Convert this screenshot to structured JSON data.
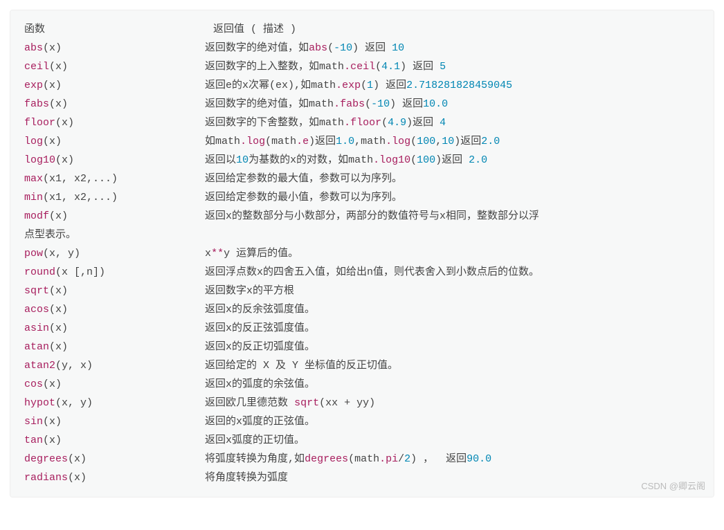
{
  "watermark": "CSDN @卿云阁",
  "lines": [
    {
      "segs": [
        {
          "t": "函数                           返回值 ( 描述 )",
          "c": "p"
        }
      ]
    },
    {
      "segs": [
        {
          "t": "abs",
          "c": "fn"
        },
        {
          "t": "(x)                       返回数字的绝对值，如",
          "c": "p"
        },
        {
          "t": "abs",
          "c": "fn"
        },
        {
          "t": "(",
          "c": "p"
        },
        {
          "t": "-10",
          "c": "num"
        },
        {
          "t": ") 返回 ",
          "c": "p"
        },
        {
          "t": "10",
          "c": "num"
        }
      ]
    },
    {
      "segs": [
        {
          "t": "ceil",
          "c": "fn"
        },
        {
          "t": "(x)                      返回数字的上入整数，如math",
          "c": "p"
        },
        {
          "t": ".ceil",
          "c": "fn"
        },
        {
          "t": "(",
          "c": "p"
        },
        {
          "t": "4.1",
          "c": "num"
        },
        {
          "t": ") 返回 ",
          "c": "p"
        },
        {
          "t": "5",
          "c": "num"
        }
      ]
    },
    {
      "segs": [
        {
          "t": "exp",
          "c": "fn"
        },
        {
          "t": "(x)                       返回e的x次幂(ex),如math",
          "c": "p"
        },
        {
          "t": ".exp",
          "c": "fn"
        },
        {
          "t": "(",
          "c": "p"
        },
        {
          "t": "1",
          "c": "num"
        },
        {
          "t": ") 返回",
          "c": "p"
        },
        {
          "t": "2.718281828459045",
          "c": "num"
        }
      ]
    },
    {
      "segs": [
        {
          "t": "fabs",
          "c": "fn"
        },
        {
          "t": "(x)                      返回数字的绝对值，如math",
          "c": "p"
        },
        {
          "t": ".fabs",
          "c": "fn"
        },
        {
          "t": "(",
          "c": "p"
        },
        {
          "t": "-10",
          "c": "num"
        },
        {
          "t": ") 返回",
          "c": "p"
        },
        {
          "t": "10.0",
          "c": "num"
        }
      ]
    },
    {
      "segs": [
        {
          "t": "floor",
          "c": "fn"
        },
        {
          "t": "(x)                     返回数字的下舍整数，如math",
          "c": "p"
        },
        {
          "t": ".floor",
          "c": "fn"
        },
        {
          "t": "(",
          "c": "p"
        },
        {
          "t": "4.9",
          "c": "num"
        },
        {
          "t": ")返回 ",
          "c": "p"
        },
        {
          "t": "4",
          "c": "num"
        }
      ]
    },
    {
      "segs": [
        {
          "t": "log",
          "c": "fn"
        },
        {
          "t": "(x)                       如math",
          "c": "p"
        },
        {
          "t": ".log",
          "c": "fn"
        },
        {
          "t": "(math",
          "c": "p"
        },
        {
          "t": ".e",
          "c": "fn"
        },
        {
          "t": ")返回",
          "c": "p"
        },
        {
          "t": "1.0",
          "c": "num"
        },
        {
          "t": ",math",
          "c": "p"
        },
        {
          "t": ".log",
          "c": "fn"
        },
        {
          "t": "(",
          "c": "p"
        },
        {
          "t": "100",
          "c": "num"
        },
        {
          "t": ",",
          "c": "p"
        },
        {
          "t": "10",
          "c": "num"
        },
        {
          "t": ")返回",
          "c": "p"
        },
        {
          "t": "2.0",
          "c": "num"
        }
      ]
    },
    {
      "segs": [
        {
          "t": "log10",
          "c": "fn"
        },
        {
          "t": "(x)                     返回以",
          "c": "p"
        },
        {
          "t": "10",
          "c": "num"
        },
        {
          "t": "为基数的x的对数，如math",
          "c": "p"
        },
        {
          "t": ".log10",
          "c": "fn"
        },
        {
          "t": "(",
          "c": "p"
        },
        {
          "t": "100",
          "c": "num"
        },
        {
          "t": ")返回 ",
          "c": "p"
        },
        {
          "t": "2.0",
          "c": "num"
        }
      ]
    },
    {
      "segs": [
        {
          "t": "max",
          "c": "fn"
        },
        {
          "t": "(x1, x2,...)              返回给定参数的最大值，参数可以为序列。",
          "c": "p"
        }
      ]
    },
    {
      "segs": [
        {
          "t": "min",
          "c": "fn"
        },
        {
          "t": "(x1, x2,...)              返回给定参数的最小值，参数可以为序列。",
          "c": "p"
        }
      ]
    },
    {
      "segs": [
        {
          "t": "modf",
          "c": "fn"
        },
        {
          "t": "(x)                      返回x的整数部分与小数部分，两部分的数值符号与x相同，整数部分以浮",
          "c": "p"
        }
      ]
    },
    {
      "segs": [
        {
          "t": "点型表示。",
          "c": "p"
        }
      ]
    },
    {
      "segs": [
        {
          "t": "pow",
          "c": "fn"
        },
        {
          "t": "(x, y)                    x",
          "c": "p"
        },
        {
          "t": "**",
          "c": "fn"
        },
        {
          "t": "y 运算后的值。",
          "c": "p"
        }
      ]
    },
    {
      "segs": [
        {
          "t": "round",
          "c": "fn"
        },
        {
          "t": "(x [,n])                返回浮点数x的四舍五入值，如给出n值，则代表舍入到小数点后的位数。",
          "c": "p"
        }
      ]
    },
    {
      "segs": [
        {
          "t": "sqrt",
          "c": "fn"
        },
        {
          "t": "(x)                      返回数字x的平方根",
          "c": "p"
        }
      ]
    },
    {
      "segs": [
        {
          "t": "acos",
          "c": "fn"
        },
        {
          "t": "(x)                      返回x的反余弦弧度值。",
          "c": "p"
        }
      ]
    },
    {
      "segs": [
        {
          "t": "asin",
          "c": "fn"
        },
        {
          "t": "(x)                      返回x的反正弦弧度值。",
          "c": "p"
        }
      ]
    },
    {
      "segs": [
        {
          "t": "atan",
          "c": "fn"
        },
        {
          "t": "(x)                      返回x的反正切弧度值。",
          "c": "p"
        }
      ]
    },
    {
      "segs": [
        {
          "t": "atan2",
          "c": "fn"
        },
        {
          "t": "(y, x)                  返回给定的 X 及 Y 坐标值的反正切值。",
          "c": "p"
        }
      ]
    },
    {
      "segs": [
        {
          "t": "cos",
          "c": "fn"
        },
        {
          "t": "(x)                       返回x的弧度的余弦值。",
          "c": "p"
        }
      ]
    },
    {
      "segs": [
        {
          "t": "hypot",
          "c": "fn"
        },
        {
          "t": "(x, y)                  返回欧几里德范数 ",
          "c": "p"
        },
        {
          "t": "sqrt",
          "c": "fn"
        },
        {
          "t": "(xx + yy)",
          "c": "p"
        }
      ]
    },
    {
      "segs": [
        {
          "t": "sin",
          "c": "fn"
        },
        {
          "t": "(x)                       返回的x弧度的正弦值。",
          "c": "p"
        }
      ]
    },
    {
      "segs": [
        {
          "t": "tan",
          "c": "fn"
        },
        {
          "t": "(x)                       返回x弧度的正切值。",
          "c": "p"
        }
      ]
    },
    {
      "segs": [
        {
          "t": "degrees",
          "c": "fn"
        },
        {
          "t": "(x)                   将弧度转换为角度,如",
          "c": "p"
        },
        {
          "t": "degrees",
          "c": "fn"
        },
        {
          "t": "(math",
          "c": "p"
        },
        {
          "t": ".pi",
          "c": "fn"
        },
        {
          "t": "/",
          "c": "p"
        },
        {
          "t": "2",
          "c": "num"
        },
        {
          "t": ") ，  返回",
          "c": "p"
        },
        {
          "t": "90.0",
          "c": "num"
        }
      ]
    },
    {
      "segs": [
        {
          "t": "radians",
          "c": "fn"
        },
        {
          "t": "(x)                   将角度转换为弧度",
          "c": "p"
        }
      ]
    }
  ]
}
